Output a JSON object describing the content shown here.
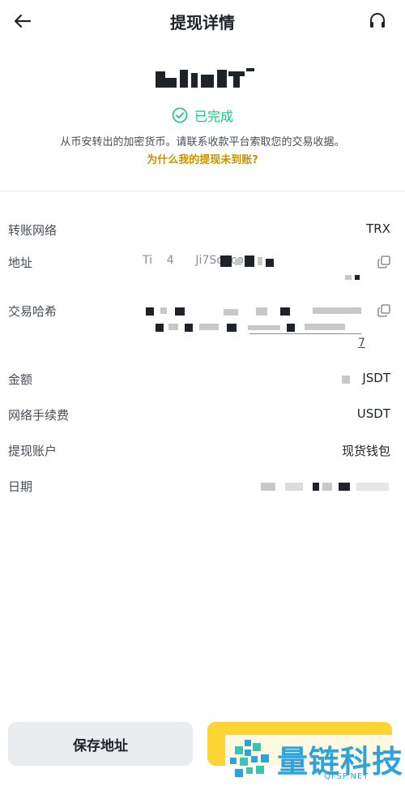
{
  "header": {
    "title": "提现详情",
    "back_icon": "arrow-left-icon",
    "support_icon": "headset-icon"
  },
  "summary": {
    "amount": "-USDT",
    "status": "已完成",
    "description": "从币安转出的加密货币。请联系收款平台索取您的交易收据。",
    "help_link": "为什么我的提现未到账?"
  },
  "details": {
    "network_label": "转账网络",
    "network_value": "TRX",
    "address_label": "地址",
    "address_value": "Ti    4      Ji7So4co  ",
    "hash_label": "交易哈希",
    "hash_value_line3": "7",
    "amount_label": "金额",
    "amount_value": "JSDT",
    "fee_label": "网络手续费",
    "fee_value": "USDT",
    "account_label": "提现账户",
    "account_value": "现货钱包",
    "date_label": "日期"
  },
  "actions": {
    "save_label": "保存地址"
  },
  "watermark": {
    "text": "量链科技",
    "sub": "QFSP.NET"
  },
  "colors": {
    "success": "#0ecb81",
    "link": "#c99400",
    "primary_button": "#fcd535",
    "secondary_button": "#eaecef"
  }
}
